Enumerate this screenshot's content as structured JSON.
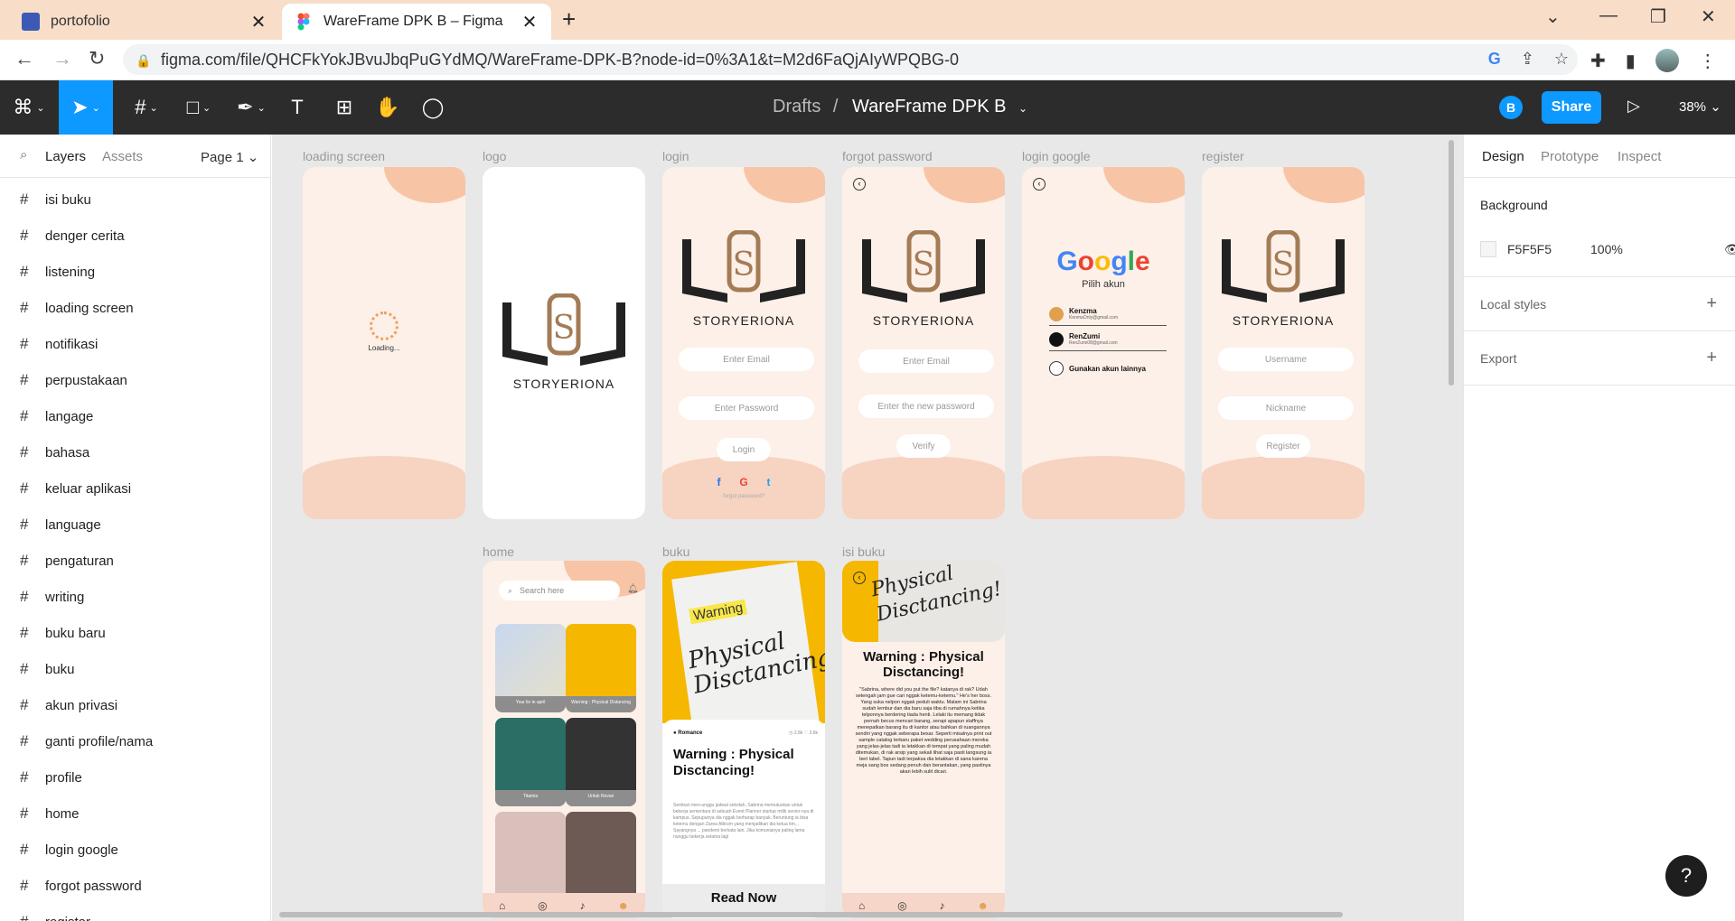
{
  "browser": {
    "tabs": [
      {
        "title": "portofolio",
        "close": "✕"
      },
      {
        "title": "WareFrame DPK B – Figma",
        "close": "✕"
      }
    ],
    "new_tab": "+",
    "url": "figma.com/file/QHCFkYokJBvuJbqPuGYdMQ/WareFrame-DPK-B?node-id=0%3A1&t=M2d6FaQjAIyWPQBG-0"
  },
  "figma": {
    "breadcrumb_root": "Drafts",
    "breadcrumb_sep": "/",
    "file_name": "WareFrame DPK B",
    "user_initial": "B",
    "share_label": "Share",
    "zoom": "38%"
  },
  "left_panel": {
    "tab_layers": "Layers",
    "tab_assets": "Assets",
    "page": "Page 1",
    "layers": [
      "isi buku",
      "denger cerita",
      "listening",
      "loading screen",
      "notifikasi",
      "perpustakaan",
      "langage",
      "bahasa",
      "keluar aplikasi",
      "language",
      "pengaturan",
      "writing",
      "buku baru",
      "buku",
      "akun privasi",
      "ganti profile/nama",
      "profile",
      "home",
      "login google",
      "forgot password",
      "register"
    ]
  },
  "canvas": {
    "frames": {
      "loading": {
        "label": "loading screen",
        "text": "Loading..."
      },
      "logo": {
        "label": "logo",
        "brand": "STORYERIONA"
      },
      "login": {
        "label": "login",
        "brand": "STORYERIONA",
        "email": "Enter Email",
        "password": "Enter Password",
        "button": "Login",
        "forgot": "forgot password?"
      },
      "forgot": {
        "label": "forgot password",
        "brand": "STORYERIONA",
        "email": "Enter Email",
        "new_password": "Enter the new password",
        "button": "Verify"
      },
      "google": {
        "label": "login google",
        "pilih": "Pilih akun",
        "accounts": [
          {
            "name": "Kenzma",
            "email": "KenmaOnly@gmail.com"
          },
          {
            "name": "RenZumi",
            "email": "RenZumi08@gmail.com"
          },
          {
            "name": "Gunakan akun lainnya",
            "email": ""
          }
        ]
      },
      "register": {
        "label": "register",
        "brand": "STORYERIONA",
        "username": "Username",
        "nickname": "Nickname",
        "button": "Register"
      },
      "home": {
        "label": "home",
        "search": "Search here",
        "cards": [
          "Your lie in april",
          "Warning : Physical Distancing",
          "Titamia",
          "Untuk Revan",
          "",
          ""
        ]
      },
      "buku": {
        "label": "buku",
        "genre": "● Romance",
        "stats": "◷ 2.8k  ♡ 3.6k",
        "warning": "Warning",
        "script": "Physical Disctancing!",
        "title": "Warning : Physical Disctancing!",
        "text": "Sembari men-unggu jadwal sekolah, Sabrina memutuskan untuk bekerja sementara di sebuah Event Planner startup milik senior-nya di kampus. Sepupunya dia nggak berharap banyak. Beruntung ia bisa ketemu dengan Zarea Albrum yang menjadikan dia ketua tim... Sayangnya ... pandemi berkata lain. Jika komunianya paling lama nunggu bekerja selama lagi",
        "read_now": "Read Now"
      },
      "isi": {
        "label": "isi buku",
        "title": "Warning : Physical Disctancing!",
        "text": "\"Sabrina, where did you put the file? katanya di rak? Udah setengah jam gue cari nggak ketemu-ketemu.\" He's her boss. Yang suka nelpon nggak peduli waktu. Malam ini Sabrina sudah lembur dan dia baru saja tiba di rumahnya ketika telponnya berdering tiada henti. Lelaki itu memang tidak pernah becus mencari barang, serapi apapun staffnya menepatkan barang itu di kantor atau bahkan di ruangannya sendiri yang nggak seberapa besar. Seperti misalnya print out sample catalog terbaru paket wedding perusahaan mereka yang jelas-jelas tadi ia letakkan di tempat yang paling mudah ditemukan, di rak arsip yang sekali lihat saja pasti langsung ia beri label. Tapun tadi terpaksa dia letakkan di sana karena meja sang bos sedang penuh dan berantakan, yang pastinya akan lebih sulit dicari."
      }
    }
  },
  "right_panel": {
    "tabs": [
      "Design",
      "Prototype",
      "Inspect"
    ],
    "background_title": "Background",
    "background_hex": "F5F5F5",
    "background_opacity": "100%",
    "local_styles": "Local styles",
    "export": "Export",
    "help": "?"
  }
}
